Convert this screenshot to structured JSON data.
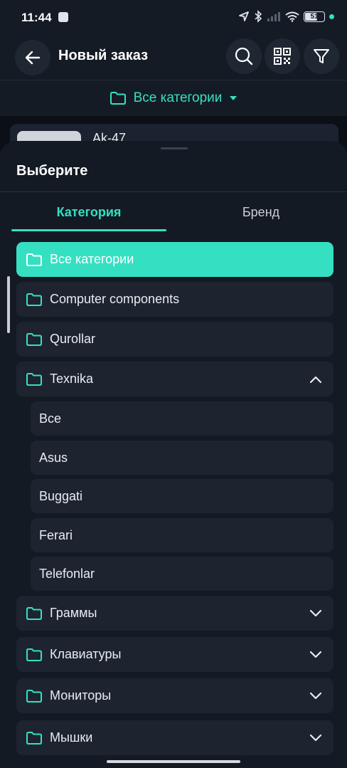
{
  "status": {
    "time": "11:44",
    "battery": "51"
  },
  "appbar": {
    "title": "Новый заказ",
    "back_icon": "arrow-left-icon",
    "search_icon": "search-icon",
    "qr_icon": "qr-code-icon",
    "filter_icon": "filter-icon"
  },
  "category_bar": {
    "label": "Все категории"
  },
  "background_product": {
    "name": "Ak-47"
  },
  "sheet": {
    "title": "Выберите",
    "tabs": [
      {
        "label": "Категория",
        "active": true
      },
      {
        "label": "Бренд",
        "active": false
      }
    ],
    "categories": [
      {
        "label": "Все категории",
        "selected": true
      },
      {
        "label": "Computer components"
      },
      {
        "label": "Qurollar"
      },
      {
        "label": "Texnika",
        "expanded": true,
        "children": [
          "Все",
          "Asus",
          "Buggati",
          "Ferari",
          "Telefonlar"
        ]
      },
      {
        "label": "Граммы",
        "expandable": true
      },
      {
        "label": "Клавиатуры",
        "expandable": true
      },
      {
        "label": "Мониторы",
        "expandable": true
      },
      {
        "label": "Мышки",
        "expandable": true
      }
    ]
  },
  "colors": {
    "accent": "#35e0c2",
    "background": "#141a24",
    "row": "#1d2430"
  }
}
